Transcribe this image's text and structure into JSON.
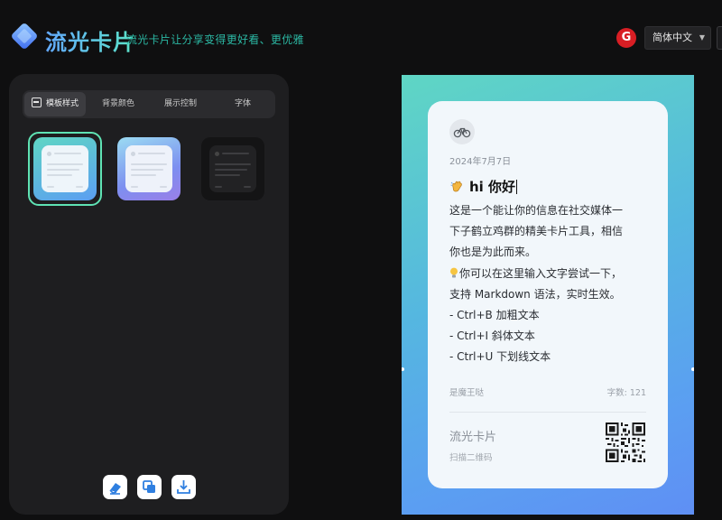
{
  "header": {
    "app_title": "流光卡片",
    "tagline": "流光卡片让分享变得更好看、更优雅",
    "language": {
      "selected": "简体中文"
    },
    "brand_color": "#d81e24",
    "brand_letter": "G"
  },
  "panel": {
    "tabs": [
      {
        "label": "模板样式",
        "active": true
      },
      {
        "label": "背景颜色",
        "active": false
      },
      {
        "label": "展示控制",
        "active": false
      },
      {
        "label": "字体",
        "active": false
      }
    ],
    "templates": [
      {
        "name": "blue-gradient",
        "selected": true
      },
      {
        "name": "purple-gradient",
        "selected": false
      },
      {
        "name": "dark",
        "selected": false
      }
    ],
    "actions": [
      {
        "icon": "eraser-icon"
      },
      {
        "icon": "copy-icon"
      },
      {
        "icon": "download-icon"
      }
    ],
    "accent": "#5fe3b4"
  },
  "card": {
    "avatar_icon": "bicycle-icon",
    "date": "2024年7月7日",
    "heading_emoji": "wave-hand-icon",
    "heading": "hi 你好",
    "lines": [
      "这是一个能让你的信息在社交媒体一",
      "下子鹤立鸡群的精美卡片工具，相信",
      "你也是为此而来。",
      "你可以在这里输入文字尝试一下，",
      "支持 Markdown 语法，实时生效。",
      "- Ctrl+B 加粗文本",
      "- Ctrl+I 斜体文本",
      "- Ctrl+U 下划线文本"
    ],
    "author": "是魔王哒",
    "word_count": "字数: 121",
    "footer_title": "流光卡片",
    "footer_subtitle": "扫描二维码"
  }
}
